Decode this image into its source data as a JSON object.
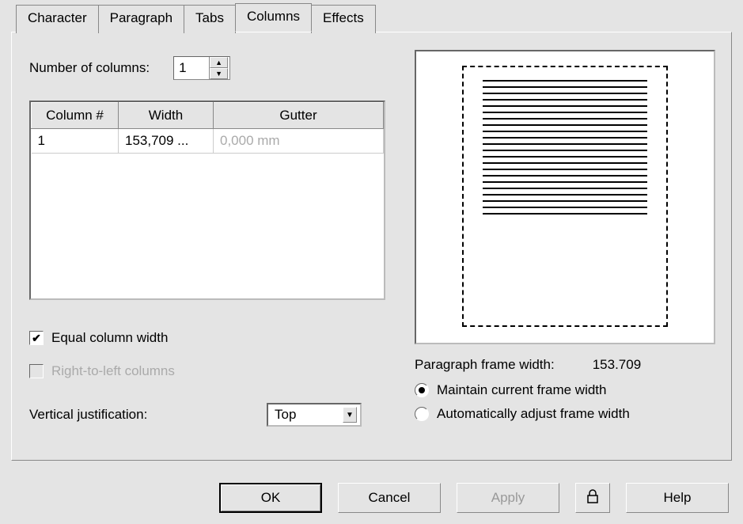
{
  "tabs": {
    "character": "Character",
    "paragraph": "Paragraph",
    "tabs": "Tabs",
    "columns": "Columns",
    "effects": "Effects"
  },
  "labels": {
    "number_of_columns": "Number of columns:",
    "vertical_justification": "Vertical justification:",
    "paragraph_frame_width": "Paragraph frame width:"
  },
  "values": {
    "column_count": "1",
    "vjust_selected": "Top",
    "frame_width_value": "153.709"
  },
  "table": {
    "headers": {
      "col": "Column #",
      "width": "Width",
      "gutter": "Gutter"
    },
    "row": {
      "num": "1",
      "width": "153,709 ...",
      "gutter": "0,000 mm"
    }
  },
  "checks": {
    "equal_width": "Equal column width",
    "rtl": "Right-to-left columns"
  },
  "radios": {
    "maintain": "Maintain current frame width",
    "auto": "Automatically adjust frame width"
  },
  "buttons": {
    "ok": "OK",
    "cancel": "Cancel",
    "apply": "Apply",
    "help": "Help"
  }
}
